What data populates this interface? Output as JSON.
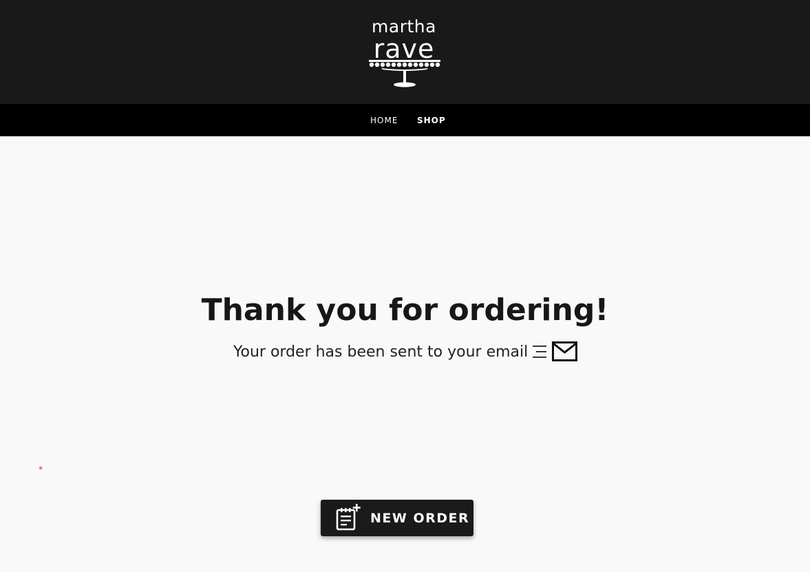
{
  "header": {
    "logo": {
      "line1": "martha",
      "line2": "rave"
    }
  },
  "nav": {
    "items": [
      {
        "label": "HOME",
        "active": false
      },
      {
        "label": "SHOP",
        "active": true
      }
    ]
  },
  "main": {
    "title": "Thank you for ordering!",
    "subtitle": "Your order has been sent to your email",
    "required_marker": "*",
    "new_order_button": {
      "label": "NEW ORDER",
      "icon": "clipboard-plus-icon"
    }
  },
  "colors": {
    "header_bg": "#191919",
    "nav_bg": "#000000",
    "page_bg": "#f9f9f9",
    "button_bg": "#1a1a1a",
    "required_marker": "#e2302b"
  },
  "icons": [
    "text-lines-icon",
    "mail-icon",
    "clipboard-plus-icon",
    "cake-stand-icon"
  ]
}
